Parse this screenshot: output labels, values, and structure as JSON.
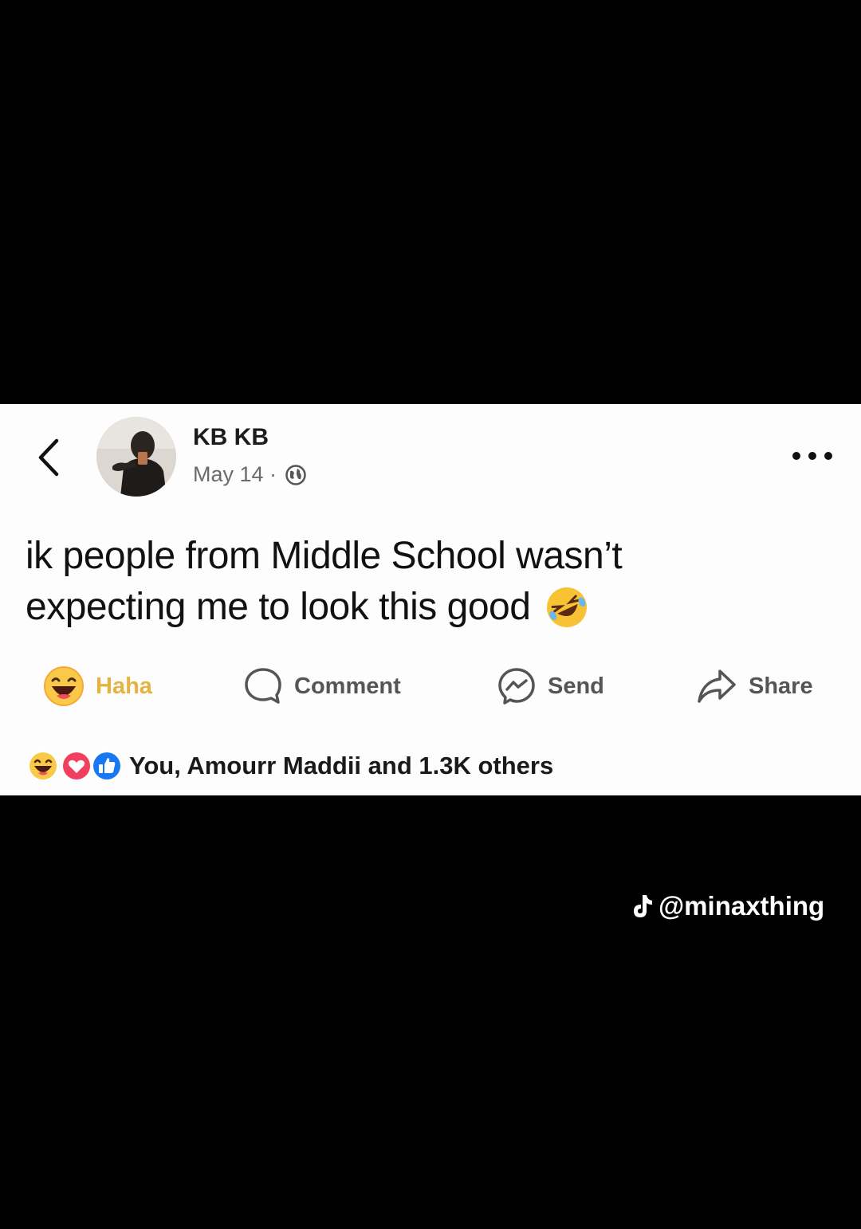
{
  "post": {
    "author": "KB KB",
    "date": "May 14 ·",
    "text_line1": "ik people from Middle School wasn’t",
    "text_line2": "expecting me to look this good"
  },
  "actions": {
    "haha": "Haha",
    "comment": "Comment",
    "send": "Send",
    "share": "Share"
  },
  "reactions": {
    "summary": "You, Amourr Maddii and 1.3K others",
    "icons": [
      "haha-icon",
      "love-icon",
      "like-icon"
    ]
  },
  "overlay": {
    "tiktok_handle": "@minaxthing"
  },
  "colors": {
    "haha": "#e6b340",
    "love": "#f0405d",
    "like": "#1877f2"
  }
}
